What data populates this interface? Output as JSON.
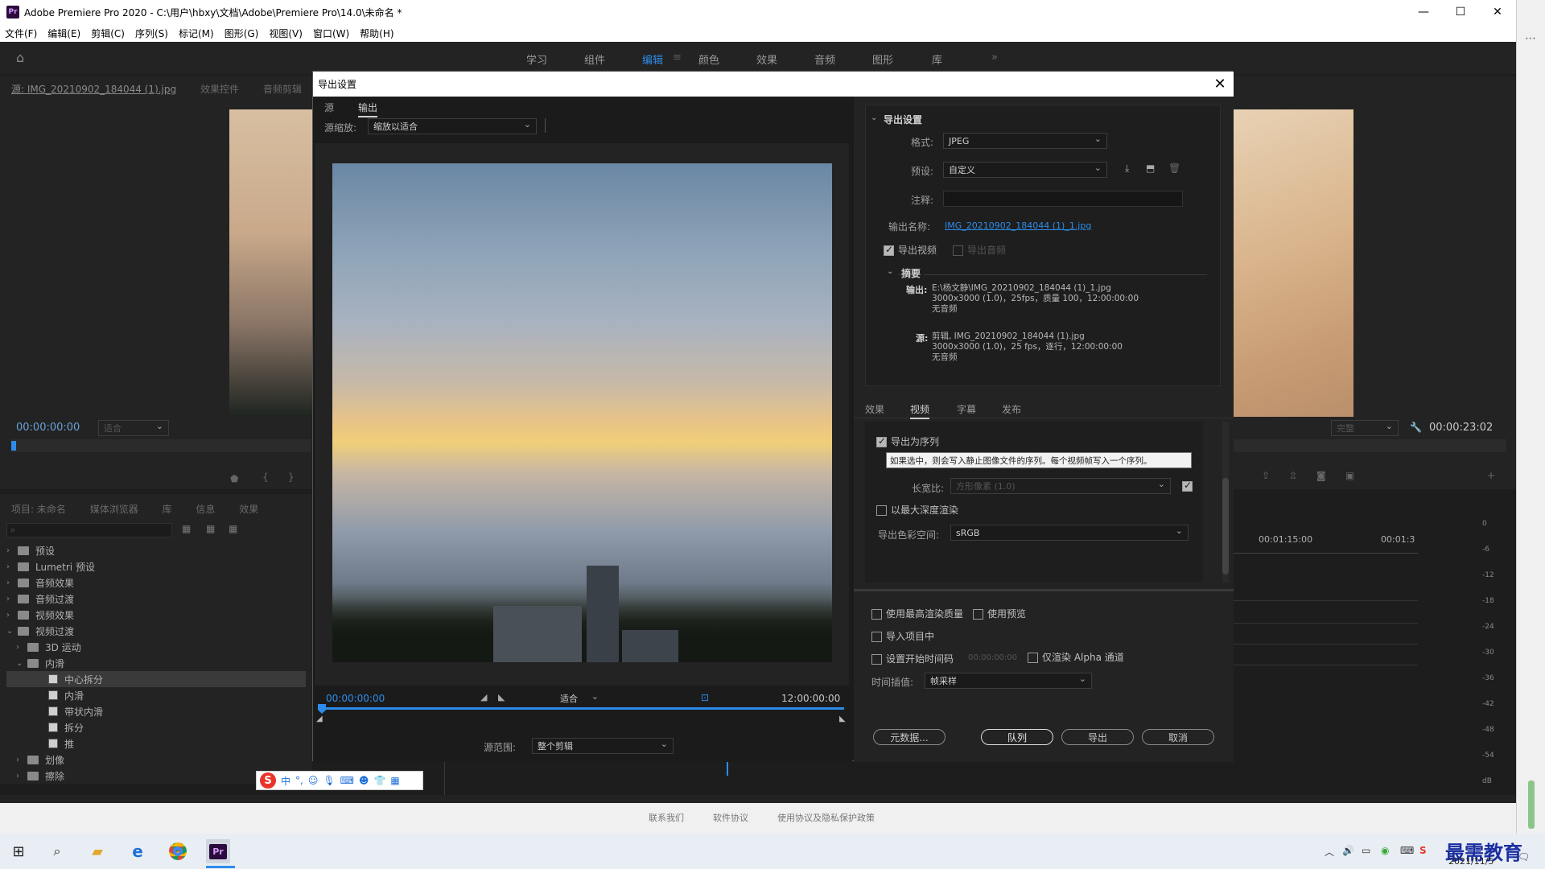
{
  "window": {
    "title": "Adobe Premiere Pro 2020 - C:\\用户\\hbxy\\文档\\Adobe\\Premiere Pro\\14.0\\未命名 *",
    "app_icon": "Pr"
  },
  "menu": [
    "文件(F)",
    "编辑(E)",
    "剪辑(C)",
    "序列(S)",
    "标记(M)",
    "图形(G)",
    "视图(V)",
    "窗口(W)",
    "帮助(H)"
  ],
  "workspaces": [
    "学习",
    "组件",
    "编辑",
    "颜色",
    "效果",
    "音频",
    "图形",
    "库"
  ],
  "workspace_more": "»",
  "source_panel": {
    "tabs": [
      "源: IMG_20210902_184044 (1).jpg",
      "效果控件",
      "音频剪辑"
    ],
    "timecode": "00:00:00:00",
    "fit": "适合"
  },
  "program_panel": {
    "timecode": "00:00:23:02",
    "fit": "完整"
  },
  "project_panel": {
    "tabs": [
      "项目: 未命名",
      "媒体浏览器",
      "库",
      "信息",
      "效果"
    ],
    "tree": [
      {
        "label": "预设",
        "level": 0,
        "type": "folder",
        "open": false
      },
      {
        "label": "Lumetri 预设",
        "level": 0,
        "type": "folder",
        "open": false
      },
      {
        "label": "音频效果",
        "level": 0,
        "type": "folder",
        "open": false
      },
      {
        "label": "音频过渡",
        "level": 0,
        "type": "folder",
        "open": false
      },
      {
        "label": "视频效果",
        "level": 0,
        "type": "folder",
        "open": false
      },
      {
        "label": "视频过渡",
        "level": 0,
        "type": "folder",
        "open": true
      },
      {
        "label": "3D 运动",
        "level": 1,
        "type": "folder",
        "open": false
      },
      {
        "label": "内滑",
        "level": 1,
        "type": "folder",
        "open": true
      },
      {
        "label": "中心拆分",
        "level": 2,
        "type": "fx",
        "selected": true
      },
      {
        "label": "内滑",
        "level": 2,
        "type": "fx"
      },
      {
        "label": "带状内滑",
        "level": 2,
        "type": "fx"
      },
      {
        "label": "拆分",
        "level": 2,
        "type": "fx"
      },
      {
        "label": "推",
        "level": 2,
        "type": "fx"
      },
      {
        "label": "划像",
        "level": 1,
        "type": "folder",
        "open": false
      },
      {
        "label": "擦除",
        "level": 1,
        "type": "folder",
        "open": false
      }
    ]
  },
  "timeline": {
    "times": [
      "00:01:15:00",
      "00:01:3"
    ],
    "meter_labels": [
      "0",
      "-6",
      "-12",
      "-18",
      "-24",
      "-30",
      "-36",
      "-42",
      "-48",
      "-54",
      "dB"
    ]
  },
  "dialog": {
    "title": "导出设置",
    "left_tabs": [
      "源",
      "输出"
    ],
    "source_scale_label": "源缩放:",
    "source_scale_value": "缩放以适合",
    "start_time": "00:00:00:00",
    "end_time": "12:00:00:00",
    "fit_value": "适合",
    "range_label": "源范围:",
    "range_value": "整个剪辑",
    "export_settings": {
      "section": "导出设置",
      "format_label": "格式:",
      "format_value": "JPEG",
      "preset_label": "预设:",
      "preset_value": "自定义",
      "comment_label": "注释:",
      "comment_value": "",
      "output_name_label": "输出名称:",
      "output_name_value": "IMG_20210902_184044 (1)_1.jpg",
      "export_video": "导出视频",
      "export_audio": "导出音频",
      "summary_title": "摘要",
      "output_label": "输出:",
      "output_lines": [
        "E:\\杨文静\\IMG_20210902_184044 (1)_1.jpg",
        "3000x3000 (1.0)，25fps，质量 100，12:00:00:00",
        "无音频"
      ],
      "source_label": "源:",
      "source_lines": [
        "剪辑, IMG_20210902_184044 (1).jpg",
        "3000x3000 (1.0)，25 fps，逐行，12:00:00:00",
        "无音频"
      ]
    },
    "right_tabs": [
      "效果",
      "视频",
      "字幕",
      "发布"
    ],
    "video": {
      "export_sequence": "导出为序列",
      "tooltip": "如果选中，则会写入静止图像文件的序列。每个视频帧写入一个序列。",
      "aspect_label": "长宽比:",
      "aspect_value": "方形像素 (1.0)",
      "max_depth": "以最大深度渲染",
      "colorspace_label": "导出色彩空间:",
      "colorspace_value": "sRGB"
    },
    "bottom": {
      "max_quality": "使用最高渲染质量",
      "use_preview": "使用预览",
      "import_project": "导入项目中",
      "set_start": "设置开始时间码",
      "start_tc": "00:00:00:00",
      "alpha_only": "仅渲染 Alpha 通道",
      "interp_label": "时间插值:",
      "interp_value": "帧采样",
      "btn_metadata": "元数据...",
      "btn_queue": "队列",
      "btn_export": "导出",
      "btn_cancel": "取消"
    }
  },
  "statusbar": [
    "联系我们",
    "软件协议",
    "使用协议及隐私保护政策"
  ],
  "taskbar": {
    "date": "2021/11/5",
    "watermark": "最需教育"
  },
  "colors": {
    "accent": "#2d8ceb",
    "panel": "#232323",
    "dialog": "#1b1b1b"
  }
}
